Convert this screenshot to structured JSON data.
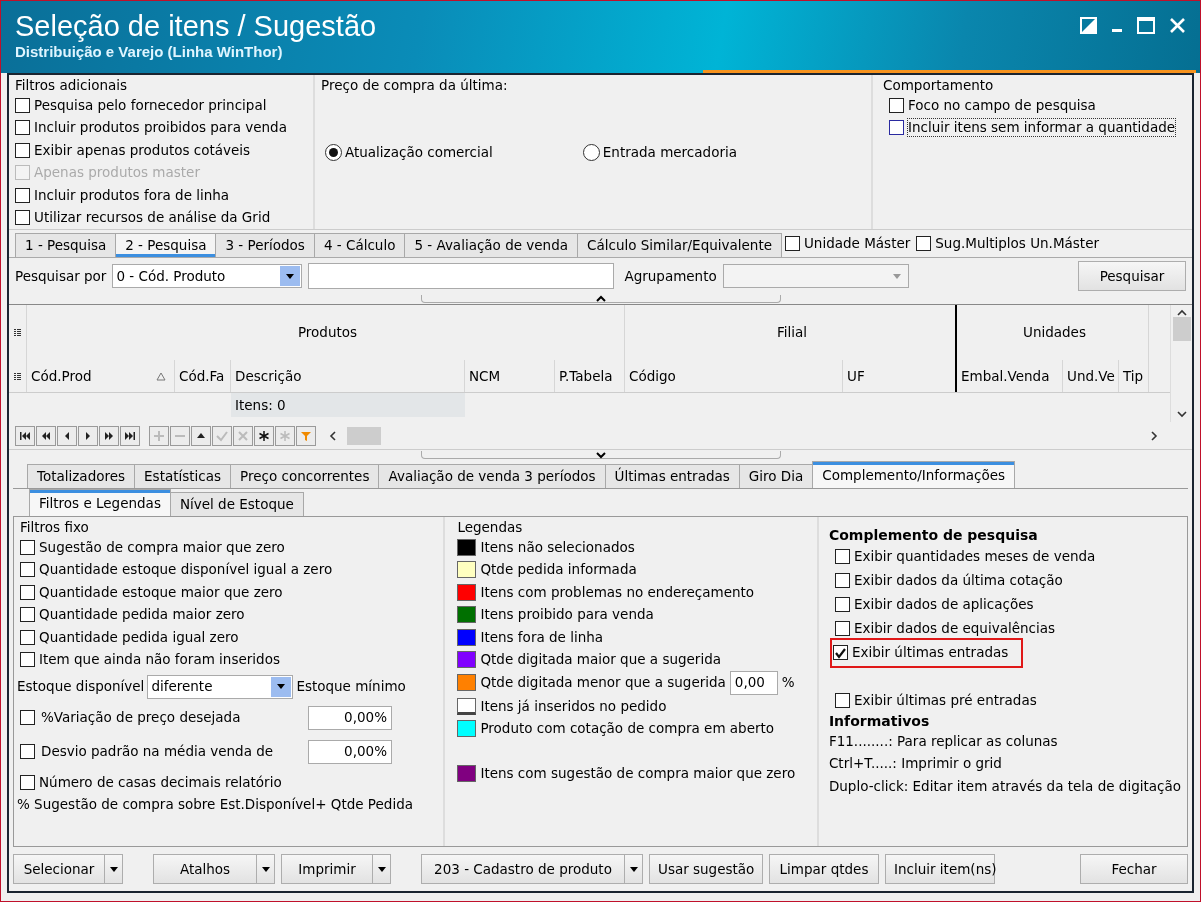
{
  "window": {
    "title": "Seleção de itens / Sugestão",
    "subtitle": "Distribuição e Varejo (Linha WinThor)"
  },
  "filters_panel": {
    "title": "Filtros adicionais",
    "items": [
      {
        "label": "Pesquisa pelo fornecedor principal",
        "checked": false,
        "disabled": false
      },
      {
        "label": "Incluir produtos proibidos para venda",
        "checked": false,
        "disabled": false
      },
      {
        "label": "Exibir apenas produtos cotáveis",
        "checked": false,
        "disabled": false
      },
      {
        "label": "Apenas produtos master",
        "checked": false,
        "disabled": true
      },
      {
        "label": "Incluir produtos fora de linha",
        "checked": false,
        "disabled": false
      },
      {
        "label": "Utilizar recursos de análise da Grid",
        "checked": false,
        "disabled": false
      }
    ]
  },
  "price_panel": {
    "title": "Preço de compra da última:",
    "options": [
      {
        "label": "Atualização comercial",
        "selected": true
      },
      {
        "label": "Entrada mercadoria",
        "selected": false
      }
    ]
  },
  "behavior_panel": {
    "title": "Comportamento",
    "items": [
      {
        "label": "Foco no campo de pesquisa",
        "checked": false,
        "focused": false
      },
      {
        "label": "Incluir itens sem informar a quantidade",
        "checked": false,
        "focused": true
      }
    ]
  },
  "search_tabs": [
    {
      "label": "1 - Pesquisa",
      "selected": false
    },
    {
      "label": "2 - Pesquisa",
      "selected": true
    },
    {
      "label": "3 - Períodos",
      "selected": false
    },
    {
      "label": "4 - Cálculo",
      "selected": false
    },
    {
      "label": "5 - Avaliação de venda",
      "selected": false
    },
    {
      "label": "Cálculo Similar/Equivalente",
      "selected": false
    }
  ],
  "header_checks": [
    {
      "label": "Unidade Máster",
      "checked": false
    },
    {
      "label": "Sug.Multiplos Un.Máster",
      "checked": false
    }
  ],
  "search_row": {
    "label": "Pesquisar por",
    "select_value": "0 - Cód. Produto",
    "grouping_label": "Agrupamento",
    "button": "Pesquisar"
  },
  "grid": {
    "bands": [
      {
        "label": "Produtos",
        "columns": [
          {
            "label": "Cód.Prod",
            "sorted": true
          },
          {
            "label": "Cód.Fa",
            "sorted": false
          },
          {
            "label": "Descrição",
            "sorted": false
          },
          {
            "label": "NCM",
            "sorted": false
          },
          {
            "label": "P.Tabela",
            "sorted": false
          }
        ]
      },
      {
        "label": "Filial",
        "columns": [
          {
            "label": "Código",
            "sorted": false
          },
          {
            "label": "UF",
            "sorted": false
          }
        ]
      },
      {
        "label": "Unidades",
        "columns": [
          {
            "label": "Embal.Venda",
            "sorted": false
          },
          {
            "label": "Und.Ve",
            "sorted": false
          },
          {
            "label": "Tip",
            "sorted": false
          }
        ]
      }
    ],
    "footer": "Itens: 0"
  },
  "result_tabs": [
    {
      "label": "Totalizadores",
      "selected": false
    },
    {
      "label": "Estatísticas",
      "selected": false
    },
    {
      "label": "Preço concorrentes",
      "selected": false
    },
    {
      "label": "Avaliação de venda 3 períodos",
      "selected": false
    },
    {
      "label": "Últimas entradas",
      "selected": false
    },
    {
      "label": "Giro Dia",
      "selected": false
    },
    {
      "label": "Complemento/Informações",
      "selected": true
    }
  ],
  "sub_tabs": [
    {
      "label": "Filtros e Legendas",
      "selected": true
    },
    {
      "label": "Nível de Estoque",
      "selected": false
    }
  ],
  "fixed_filters": {
    "title": "Filtros fixo",
    "items": [
      {
        "label": "Sugestão de compra maior que zero",
        "checked": false
      },
      {
        "label": "Quantidade estoque disponível igual a zero",
        "checked": false
      },
      {
        "label": "Quantidade estoque maior que zero",
        "checked": false
      },
      {
        "label": "Quantidade pedida maior zero",
        "checked": false
      },
      {
        "label": "Quantidade pedida igual zero",
        "checked": false
      },
      {
        "label": "Item que ainda não foram inseridos",
        "checked": false
      }
    ],
    "stock_label": "Estoque disponível",
    "stock_value": "diferente",
    "stock_label_2": "Estoque mínimo",
    "numeric": [
      {
        "label": "%Variação de preço desejada",
        "checked": false,
        "value": "0,00%"
      },
      {
        "label": "Desvio padrão na média venda de",
        "checked": false,
        "value": "0,00%"
      }
    ],
    "decimals": {
      "label": "Número de casas decimais relatório",
      "checked": false
    },
    "note": "% Sugestão de compra sobre Est.Disponível+ Qtde Pedida"
  },
  "legend": {
    "title": "Legendas",
    "items": [
      {
        "label": "Itens não selecionados",
        "color": "#000000"
      },
      {
        "label": "Qtde pedida informada",
        "color": "#ffffc0"
      },
      {
        "label": "Itens com problemas no endereçamento",
        "color": "#ff0000"
      },
      {
        "label": "Itens proibido para venda",
        "color": "#007000"
      },
      {
        "label": "Itens fora de linha",
        "color": "#0000ff"
      },
      {
        "label": "Qtde digitada maior que a sugerida",
        "color": "#8000ff"
      },
      {
        "label": "Qtde digitada menor que a sugerida",
        "color": "#ff8000",
        "value": "0,00",
        "unit": "%"
      },
      {
        "label": "Itens já inseridos no pedido",
        "color": "#ffffff"
      },
      {
        "label": "Produto com cotação de compra em aberto",
        "color": "#00ffff"
      },
      {
        "label": "Itens com sugestão de compra maior que zero",
        "color": "#800080"
      }
    ]
  },
  "complement": {
    "title": "Complemento de pesquisa",
    "items": [
      {
        "label": "Exibir quantidades meses de venda",
        "checked": false,
        "highlighted": false
      },
      {
        "label": "Exibir dados da última cotação",
        "checked": false,
        "highlighted": false
      },
      {
        "label": "Exibir dados de aplicações",
        "checked": false,
        "highlighted": false
      },
      {
        "label": "Exibir dados de equivalências",
        "checked": false,
        "highlighted": false
      },
      {
        "label": "Exibir últimas entradas",
        "checked": true,
        "highlighted": true
      },
      {
        "label": "Exibir últimas pré entradas",
        "checked": false,
        "highlighted": false
      }
    ],
    "info_title": "Informativos",
    "info": [
      "F11........: Para replicar as colunas",
      "Ctrl+T.....: Imprimir o grid",
      "Duplo-click: Editar item através da tela de digitação"
    ]
  },
  "buttons": [
    {
      "label": "Selecionar",
      "dropdown": true
    },
    {
      "label": "Atalhos",
      "dropdown": true
    },
    {
      "label": "Imprimir",
      "dropdown": true
    },
    {
      "label": "203 - Cadastro de produto",
      "dropdown": true
    },
    {
      "label": "Usar sugestão",
      "dropdown": false
    },
    {
      "label": "Limpar qtdes",
      "dropdown": false
    },
    {
      "label": "Incluir item(ns)",
      "dropdown": false
    },
    {
      "label": "Fechar",
      "dropdown": false
    }
  ]
}
